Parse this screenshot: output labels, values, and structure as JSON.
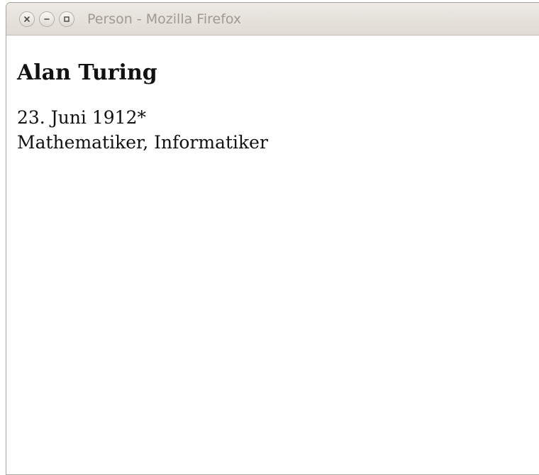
{
  "window": {
    "title": "Person - Mozilla Firefox"
  },
  "person": {
    "name": "Alan Turing",
    "birth": "23. Juni 1912*",
    "profession": "Mathematiker, Informatiker"
  },
  "icons": {
    "close": "close-icon",
    "minimize": "minimize-icon",
    "maximize": "maximize-icon"
  },
  "colors": {
    "titlebar": "#e6e2dc",
    "title_text": "#a09a92",
    "content_text": "#111111"
  }
}
